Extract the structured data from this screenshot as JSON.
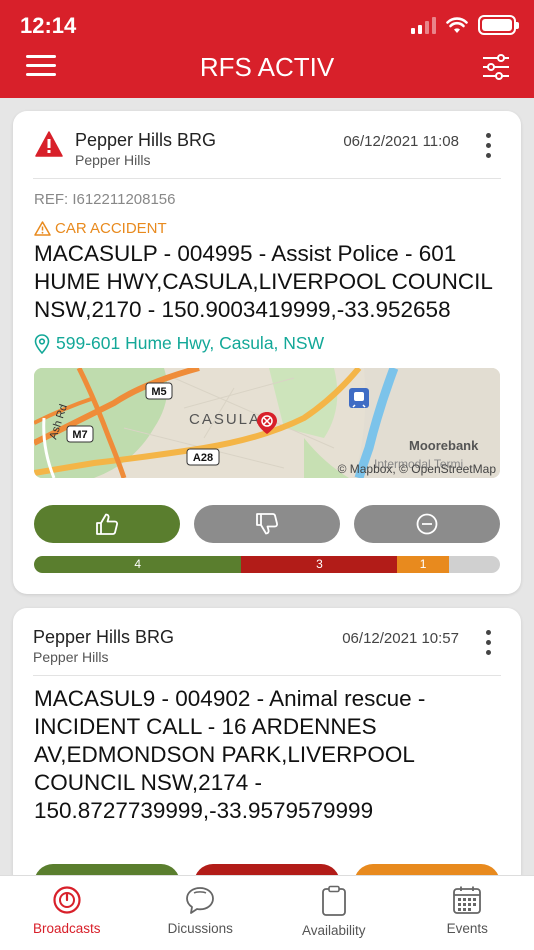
{
  "status": {
    "time": "12:14"
  },
  "app": {
    "title": "RFS ACTIV"
  },
  "colors": {
    "brand": "#d8202a",
    "accept": "#5a7e2e",
    "decline": "#b21c18",
    "maybe": "#e88a1e",
    "address": "#13a898"
  },
  "broadcasts": [
    {
      "unit": "Pepper Hills BRG",
      "sub": "Pepper Hills",
      "datetime": "06/12/2021 11:08",
      "ref": "REF: I612211208156",
      "category": "CAR ACCIDENT",
      "message": "MACASULP - 004995 - Assist Police - 601 HUME HWY,CASULA,LIVERPOOL COUNCIL NSW,2170 - 150.9003419999,-33.952658",
      "address": "599-601 Hume Hwy, Casula, NSW",
      "map": {
        "labels": [
          "M5",
          "M7",
          "A28",
          "Ash Rd",
          "CASULA",
          "Moorebank",
          "Intermodal Termi"
        ],
        "attribution": "© Mapbox, © OpenStreetMap"
      },
      "tally": {
        "yes": "4",
        "no": "3",
        "maybe": "1",
        "yes_frac": 0.445,
        "no_frac": 0.335,
        "maybe_frac": 0.11
      }
    },
    {
      "unit": "Pepper Hills BRG",
      "sub": "Pepper Hills",
      "datetime": "06/12/2021 10:57",
      "message": "MACASUL9 - 004902 - Animal rescue - INCIDENT CALL - 16 ARDENNES AV,EDMONDSON PARK,LIVERPOOL COUNCIL NSW,2174 - 150.8727739999,-33.9579579999"
    }
  ],
  "nav": [
    {
      "label": "Broadcasts",
      "icon": "broadcast-icon",
      "active": true
    },
    {
      "label": "Dicussions",
      "icon": "chat-bubbles-icon"
    },
    {
      "label": "Availability",
      "icon": "clipboard-icon"
    },
    {
      "label": "Events",
      "icon": "calendar-icon"
    }
  ]
}
